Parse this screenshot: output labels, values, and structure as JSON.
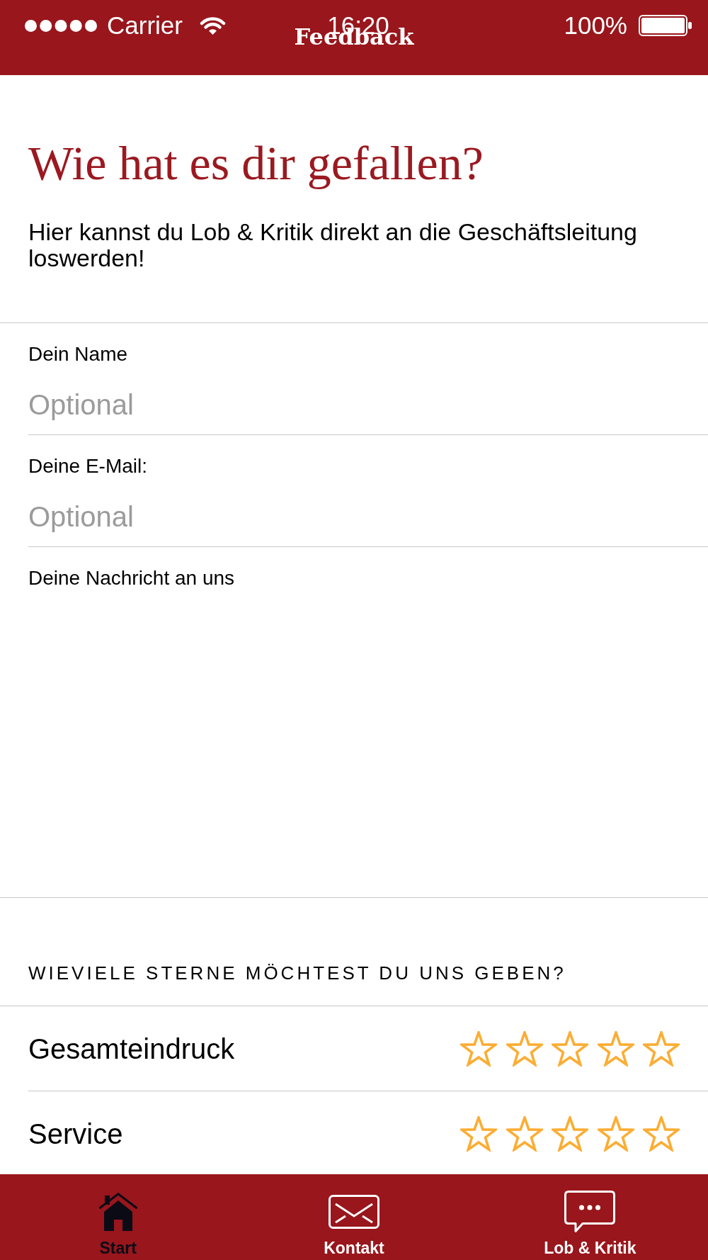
{
  "status_bar": {
    "carrier": "Carrier",
    "time": "16:20",
    "battery": "100%"
  },
  "nav_bar": {
    "title": "Feedback"
  },
  "intro": {
    "heading": "Wie hat es dir gefallen?",
    "text": "Hier kannst du Lob & Kritik direkt an die Geschäftsleitung loswerden!"
  },
  "form": {
    "fields": [
      {
        "kind": "input",
        "label": "Dein Name",
        "placeholder": "Optional"
      },
      {
        "kind": "input",
        "label": "Deine E-Mail:",
        "placeholder": "Optional"
      },
      {
        "kind": "textarea",
        "label": "Deine Nachricht an uns"
      }
    ]
  },
  "ratings": {
    "heading": "WIEVIELE STERNE MÖCHTEST DU UNS GEBEN?",
    "items": [
      {
        "label": "Gesamteindruck",
        "stars": 0
      },
      {
        "label": "Service",
        "stars": 0
      }
    ]
  },
  "tab_bar": [
    {
      "label": "Start",
      "selected": true
    },
    {
      "label": "Kontakt",
      "selected": false
    },
    {
      "label": "Lob & Kritik",
      "selected": false
    }
  ]
}
